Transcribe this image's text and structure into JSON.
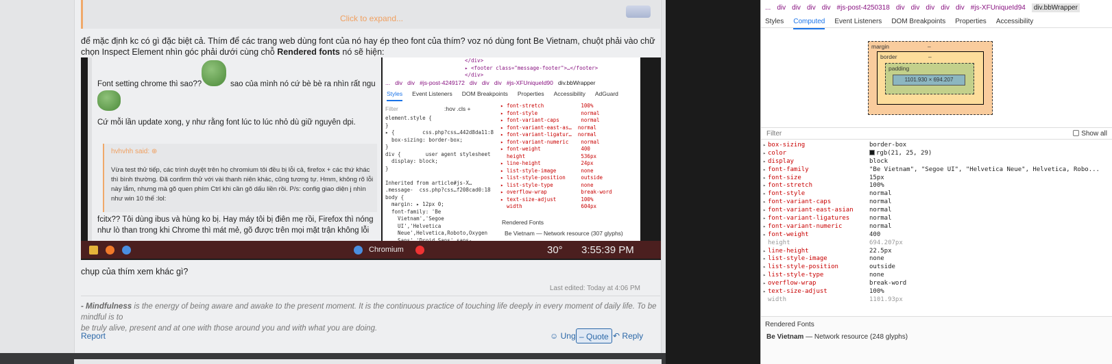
{
  "forum": {
    "quote_expand": "Click to expand...",
    "para1": "để mặc định kc có gì đặc biệt cả. Thím để các trang web dùng font của nó hay ép theo font của thím? voz nó dùng font Be Vietnam, chuột phải vào chữ",
    "para2_pre": "chọn Inspect Element nhìn góc phải dưới cùng chỗ ",
    "para2_bold": "Rendered fonts",
    "para2_post": " nó sẽ hiện:",
    "after_screenshot": "chụp của thím xem khác gì?",
    "edited": "Last edited: Today at 4:06 PM",
    "sig_bold": "- Mindfulness",
    "sig_line1": " is the energy of being aware and awake to the present moment. It is the continuous practice of touching life deeply in every moment of daily life. To be mindful is to",
    "sig_line2": "be truly alive, present and at one with those around you and with what you are doing.",
    "report": "Report",
    "ung": "Ung",
    "quote": "Quote",
    "reply": "Reply"
  },
  "screenshot": {
    "line1": "Font setting chrome thì sao??",
    "line1b": "sao của mình nó cứ bè bè ra nhìn rất ngu",
    "line2": "Cứ mỗi lần update xong, y như rằng font lúc to lúc nhỏ dù giữ nguyên dpi.",
    "quote_who": "hvhvhh said: ⊕",
    "quote_text": "Vừa test thử tiếp, các trình duyệt trên họ chromium tôi đều bị lỗi cả, firefox + các thứ khác thì bình thường. Đã confirm thử với vài thanh niên khác, cũng tương tự. Hmm, không rõ lỗi này lắm, nhưng mà gõ quen phím Ctrl khi cần gõ dấu liền rồi. P/s: config giao diện j nhìn như win 10 thế :lol:",
    "line3": "fcitx?? Tôi dùng ibus và hùng ko bị. Hay máy tôi bị điên mẹ rồi, Firefox thì nóng",
    "line4": "như lò than trong khi Chrome thì mát mẻ, gõ được trên mọi mặt trận không lỗi",
    "dev_crumbs": [
      "...",
      "div",
      "div",
      "#js-post-4249172",
      "div",
      "div",
      "div",
      "#js-XFUniqueId90",
      "div.bbWrapper"
    ],
    "dev_tabs": [
      "Styles",
      "Event Listeners",
      "DOM Breakpoints",
      "Properties",
      "Accessibility",
      "AdGuard"
    ],
    "dev_filter": "Filter",
    "dev_hov": ":hov .cls +",
    "dev_rendered": "Rendered Fonts",
    "dev_font": "Be Vietnam — Network resource (307 glyphs)",
    "taskbar_app": "Chromium",
    "taskbar_temp": "30°",
    "taskbar_clock": "3:55:39 PM"
  },
  "devtools": {
    "crumbs": [
      "...",
      "div",
      "div",
      "div",
      "div",
      "#js-post-4250318",
      "div",
      "div",
      "div",
      "div",
      "div",
      "#js-XFUniqueId94",
      "div.bbWrapper"
    ],
    "tabs": [
      "Styles",
      "Computed",
      "Event Listeners",
      "DOM Breakpoints",
      "Properties",
      "Accessibility"
    ],
    "active_tab": "Computed",
    "box": {
      "margin": "margin",
      "border": "border",
      "padding": "padding",
      "content": "1101.930 × 694.207",
      "dash": "–"
    },
    "filter_placeholder": "Filter",
    "show_all": "Show all",
    "properties": [
      {
        "name": "box-sizing",
        "value": "border-box"
      },
      {
        "name": "color",
        "value": "rgb(21, 25, 29)"
      },
      {
        "name": "display",
        "value": "block"
      },
      {
        "name": "font-family",
        "value": "\"Be Vietnam\", \"Segoe UI\", \"Helvetica Neue\", Helvetica, Robo..."
      },
      {
        "name": "font-size",
        "value": "15px"
      },
      {
        "name": "font-stretch",
        "value": "100%"
      },
      {
        "name": "font-style",
        "value": "normal"
      },
      {
        "name": "font-variant-caps",
        "value": "normal"
      },
      {
        "name": "font-variant-east-asian",
        "value": "normal"
      },
      {
        "name": "font-variant-ligatures",
        "value": "normal"
      },
      {
        "name": "font-variant-numeric",
        "value": "normal"
      },
      {
        "name": "font-weight",
        "value": "400"
      },
      {
        "name": "height",
        "value": "694.207px",
        "dim": true
      },
      {
        "name": "line-height",
        "value": "22.5px"
      },
      {
        "name": "list-style-image",
        "value": "none"
      },
      {
        "name": "list-style-position",
        "value": "outside"
      },
      {
        "name": "list-style-type",
        "value": "none"
      },
      {
        "name": "overflow-wrap",
        "value": "break-word"
      },
      {
        "name": "text-size-adjust",
        "value": "100%"
      },
      {
        "name": "width",
        "value": "1101.93px",
        "dim": true
      }
    ],
    "rendered_title": "Rendered Fonts",
    "rendered_font": "Be Vietnam",
    "rendered_src": "Network resource (248 glyphs)"
  },
  "colors": {
    "accent": "#1a73e8",
    "quote": "#f0a96a",
    "link": "#2a67a8"
  }
}
